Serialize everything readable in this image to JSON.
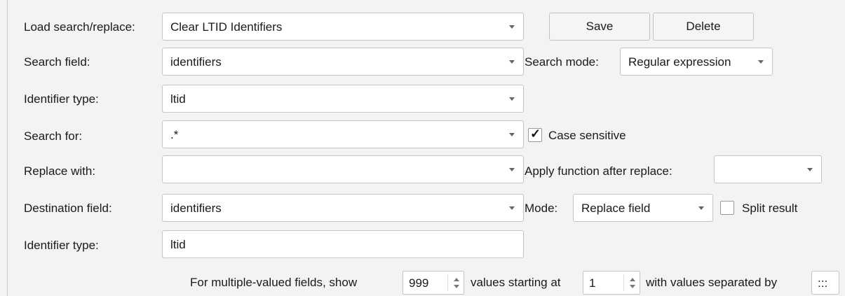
{
  "load_search_replace": {
    "label": "Load search/replace:",
    "value": "Clear LTID Identifiers",
    "save_label": "Save",
    "delete_label": "Delete"
  },
  "search_field": {
    "label": "Search field:",
    "value": "identifiers",
    "mode_label": "Search mode:",
    "mode_value": "Regular expression"
  },
  "identifier_type_1": {
    "label": "Identifier type:",
    "value": "ltid"
  },
  "search_for": {
    "label": "Search for:",
    "value": ".*",
    "case_sensitive_label": "Case sensitive",
    "case_sensitive_checked": true
  },
  "replace_with": {
    "label": "Replace with:",
    "value": "",
    "apply_function_label": "Apply function after replace:",
    "apply_function_value": ""
  },
  "destination_field": {
    "label": "Destination field:",
    "value": "identifiers",
    "mode_label": "Mode:",
    "mode_value": "Replace field",
    "split_result_label": "Split result",
    "split_result_checked": false
  },
  "identifier_type_2": {
    "label": "Identifier type:",
    "value": "ltid"
  },
  "multiple_values": {
    "text_show": "For multiple-valued fields, show",
    "show_count": "999",
    "text_starting": "values starting at",
    "start_at": "1",
    "text_separated": "with values separated by",
    "separator": ":::"
  }
}
